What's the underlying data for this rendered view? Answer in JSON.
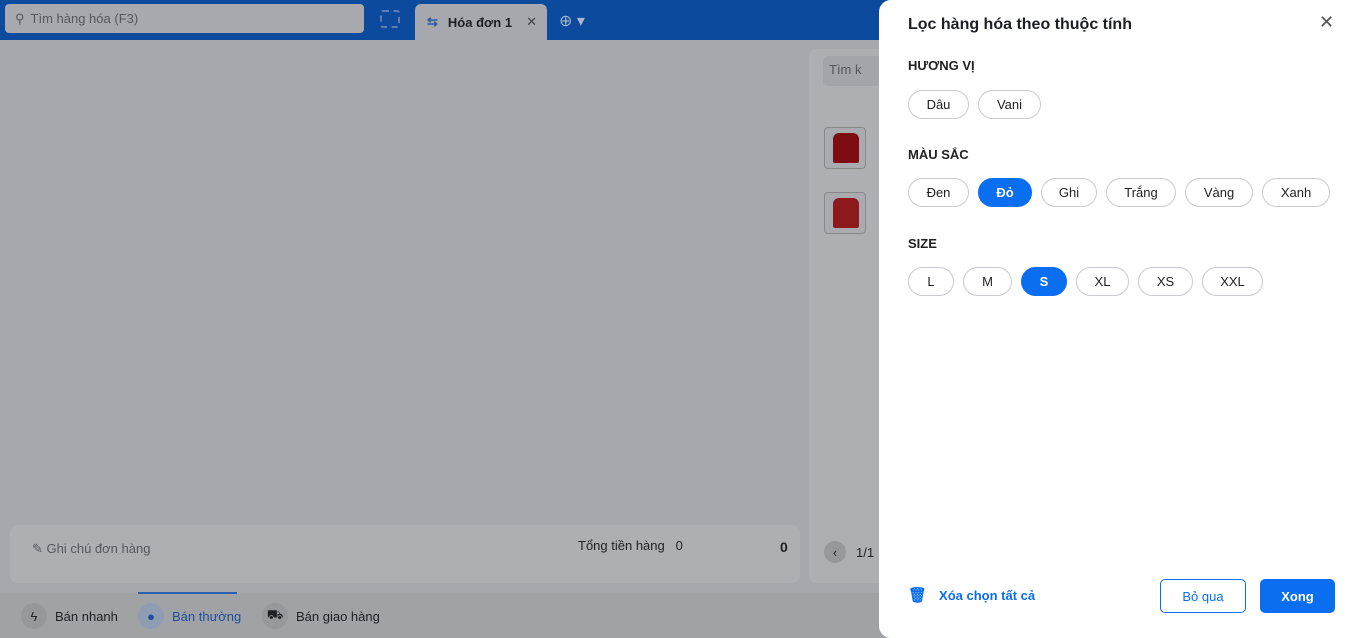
{
  "topbar": {
    "search_placeholder": "Tìm hàng hóa (F3)",
    "tab_label": "Hóa đơn 1"
  },
  "right_panel": {
    "search_placeholder": "Tìm k",
    "pagination": "1/1"
  },
  "order": {
    "note_placeholder": "Ghi chú đơn hàng",
    "total_label": "Tổng tiền hàng",
    "total_count": "0",
    "total_amount": "0"
  },
  "modes": [
    {
      "label": "Bán nhanh"
    },
    {
      "label": "Bán thường",
      "active": true
    },
    {
      "label": "Bán giao hàng"
    }
  ],
  "drawer": {
    "title": "Lọc hàng hóa theo thuộc tính",
    "groups": [
      {
        "label": "HƯƠNG VỊ",
        "options": [
          "Dâu",
          "Vani"
        ],
        "selected": []
      },
      {
        "label": "MÀU SẮC",
        "options": [
          "Đen",
          "Đỏ",
          "Ghi",
          "Trắng",
          "Vàng",
          "Xanh"
        ],
        "selected": [
          "Đỏ"
        ]
      },
      {
        "label": "SIZE",
        "options": [
          "L",
          "M",
          "S",
          "XL",
          "XS",
          "XXL"
        ],
        "selected": [
          "S"
        ]
      }
    ],
    "clear_all": "Xóa chọn tất cả",
    "cancel": "Bỏ qua",
    "done": "Xong"
  },
  "colors": {
    "accent": "#0a6ef0",
    "topbar": "#0b4a9c"
  }
}
